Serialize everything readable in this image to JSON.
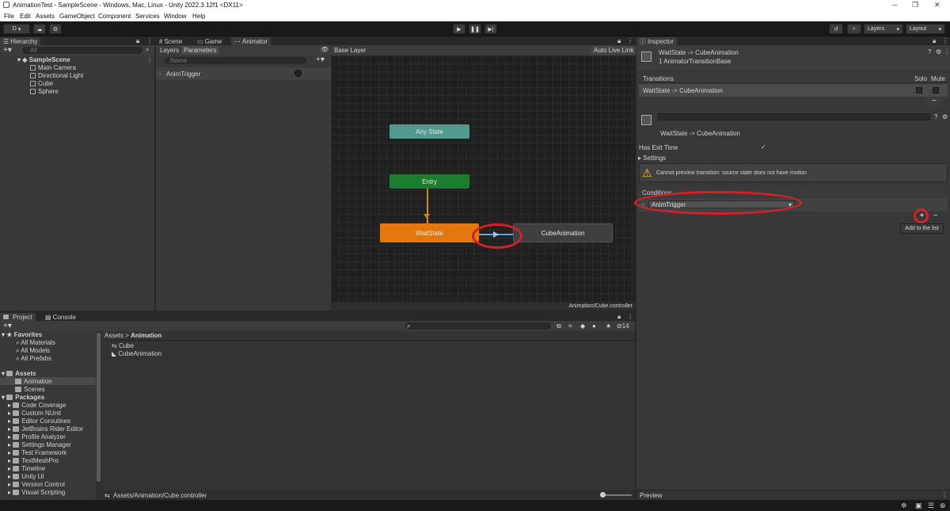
{
  "window": {
    "title": "AnimationTest - SampleScene - Windows, Mac, Linux - Unity 2022.3.12f1 <DX11>"
  },
  "menu": [
    "File",
    "Edit",
    "Assets",
    "GameObject",
    "Component",
    "Services",
    "Window",
    "Help"
  ],
  "toolbar": {
    "account": "D",
    "layers": "Layers",
    "layout": "Layout"
  },
  "hierarchy": {
    "tab": "Hierarchy",
    "search_placeholder": "All",
    "scene": "SampleScene",
    "items": [
      "Main Camera",
      "Directional Light",
      "Cube",
      "Sphere"
    ]
  },
  "center_tabs": {
    "scene": "Scene",
    "game": "Game",
    "animator": "Animator"
  },
  "animator": {
    "layers_tab": "Layers",
    "params_tab": "Parameters",
    "search_placeholder": "Name",
    "param": "AnimTrigger",
    "breadcrumb": "Base Layer",
    "live_link": "Auto Live Link",
    "nodes": {
      "any": "Any State",
      "entry": "Entry",
      "wait": "WaitState",
      "cube": "CubeAnimation"
    },
    "footer": "Animation/Cube.controller"
  },
  "inspector": {
    "tab": "Inspector",
    "header_title": "WaitState -> CubeAnimation",
    "header_sub": "1 AnimatorTransitionBase",
    "transitions_label": "Transitions",
    "solo": "Solo",
    "mute": "Mute",
    "transition_row": "WaitState -> CubeAnimation",
    "transition_name": "WaitState -> CubeAnimation",
    "has_exit_time": "Has Exit Time",
    "settings": "Settings",
    "warning": "Cannot preview transition: source state does not have motion",
    "conditions": "Conditions",
    "condition_value": "AnimTrigger",
    "tooltip": "Add to the list",
    "preview": "Preview"
  },
  "bottom_tabs": {
    "project": "Project",
    "console": "Console"
  },
  "project": {
    "favorites": "Favorites",
    "fav_items": [
      "All Materials",
      "All Models",
      "All Prefabs"
    ],
    "assets": "Assets",
    "asset_items": [
      "Animation",
      "Scenes"
    ],
    "packages": "Packages",
    "package_items": [
      "Code Coverage",
      "Custom NUnit",
      "Editor Coroutines",
      "JetBrains Rider Editor",
      "Profile Analyzer",
      "Settings Manager",
      "Test Framework",
      "TextMeshPro",
      "Timeline",
      "Unity UI",
      "Version Control",
      "Visual Scripting"
    ],
    "breadcrumb_root": "Assets",
    "breadcrumb_leaf": "Animation",
    "files": [
      "Cube",
      "CubeAnimation"
    ],
    "hidden_count": "14",
    "footer_path": "Assets/Animation/Cube.controller"
  },
  "colors": {
    "accent_red": "#d3202a",
    "wait_state": "#e2780f",
    "entry": "#1c7d31",
    "any_state": "#4f9a8c"
  }
}
